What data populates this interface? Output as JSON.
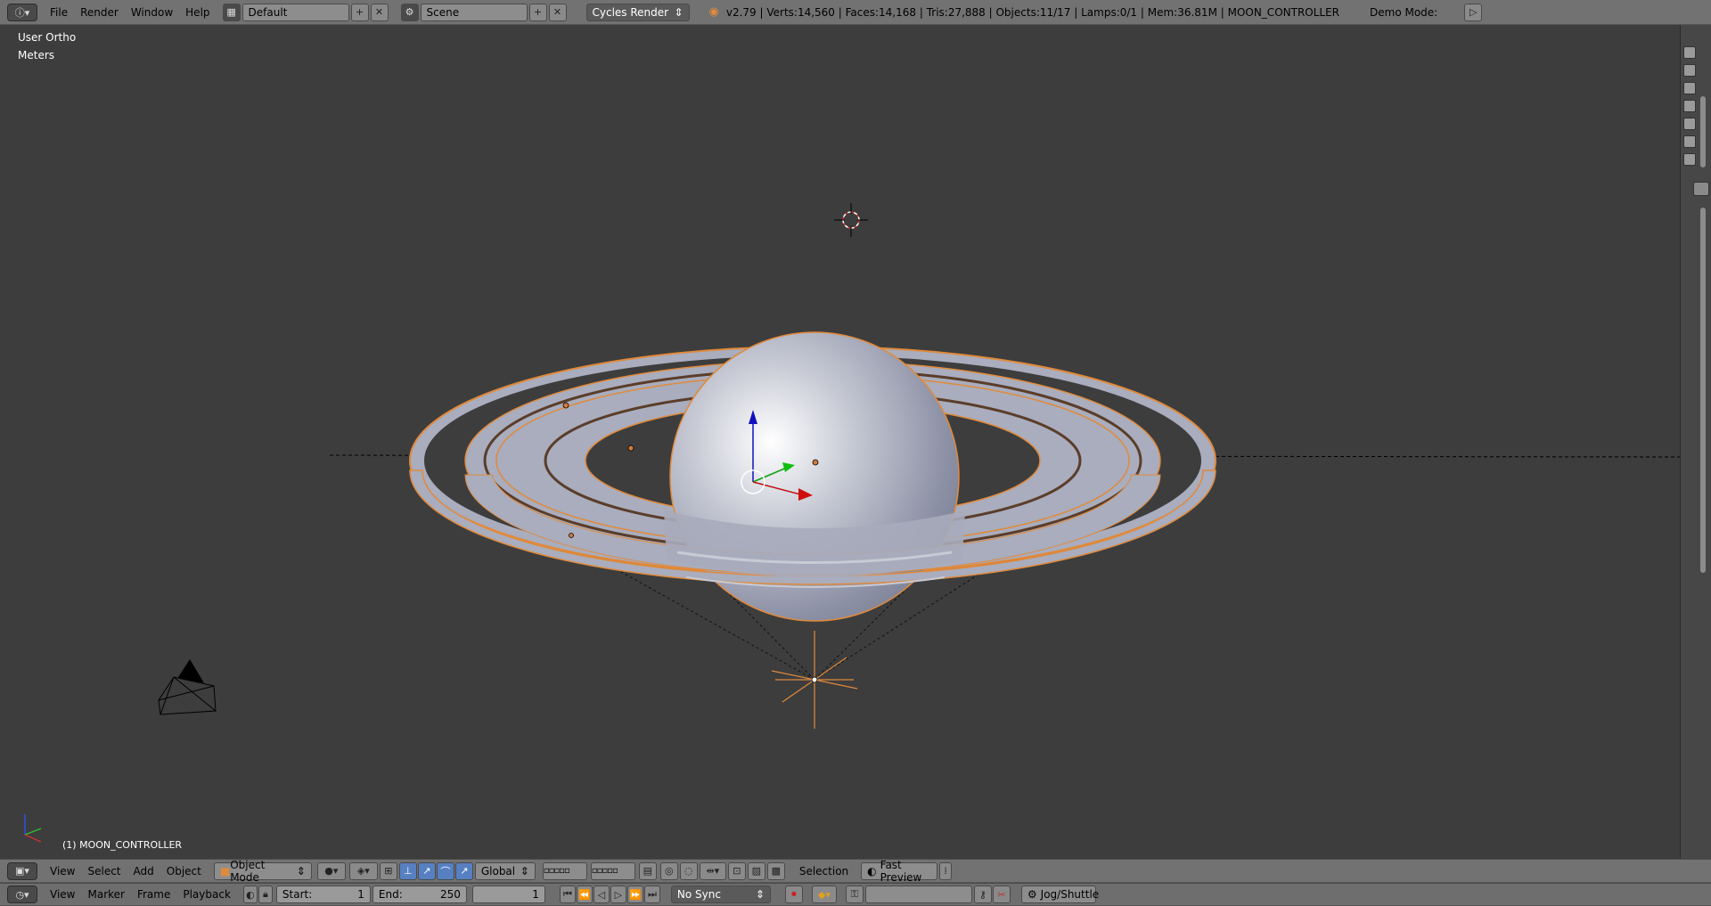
{
  "topbar": {
    "editor_type_icon": "info-icon",
    "menus": [
      "File",
      "Render",
      "Window",
      "Help"
    ],
    "layout_name": "Default",
    "scene_name": "Scene",
    "render_engine": "Cycles Render",
    "stats": "v2.79 | Verts:14,560 | Faces:14,168 | Tris:27,888 | Objects:11/17 | Lamps:0/1 | Mem:36.81M | MOON_CONTROLLER",
    "demo_mode_label": "Demo Mode:"
  },
  "viewport": {
    "view_name": "User Ortho",
    "units": "Meters",
    "active_object_label": "(1) MOON_CONTROLLER"
  },
  "viewport_header": {
    "menus": [
      "View",
      "Select",
      "Add",
      "Object"
    ],
    "mode": "Object Mode",
    "orientation": "Global",
    "pivot_label": "Selection",
    "render_preset": "Fast Preview"
  },
  "timeline_header": {
    "menus": [
      "View",
      "Marker",
      "Frame",
      "Playback"
    ],
    "start_label": "Start:",
    "start_value": "1",
    "end_label": "End:",
    "end_value": "250",
    "current_frame": "1",
    "sync_mode": "No Sync",
    "jog_label": "Jog/Shuttle"
  },
  "colors": {
    "selection_orange": "#e08a3c",
    "ring_fill": "#a9adbd",
    "viewport_bg": "#3d3d3d",
    "header_bg": "#727272"
  }
}
